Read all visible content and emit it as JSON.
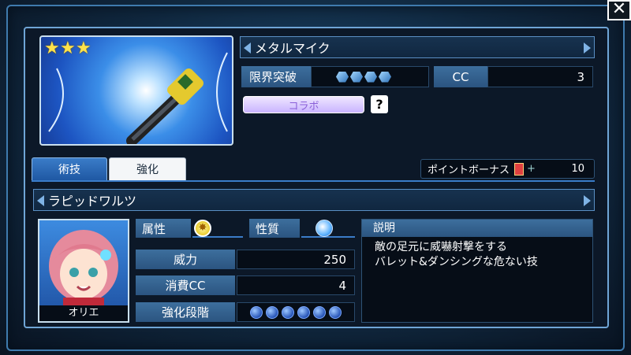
{
  "item": {
    "name": "メタルマイク",
    "stars": 3,
    "limit_break_label": "限界突破",
    "limit_break_level": 4,
    "cc_label": "CC",
    "cc_value": "3",
    "collab_label": "コラボ",
    "help_symbol": "?"
  },
  "tabs": [
    {
      "label": "術技",
      "active": true
    },
    {
      "label": "強化",
      "active": false
    }
  ],
  "point_bonus": {
    "label": "ポイントボーナス",
    "value": "10",
    "plus": "+"
  },
  "skill": {
    "name": "ラピッドワルツ",
    "character_name": "オリエ",
    "attribute_label": "属性",
    "attribute_icon": "light-element-icon",
    "property_label": "性質",
    "property_icon": "water-swirl-icon",
    "power_label": "威力",
    "power_value": "250",
    "cost_label": "消費CC",
    "cost_value": "4",
    "enhance_label": "強化段階",
    "enhance_level": 0,
    "enhance_max": 6,
    "description_label": "説明",
    "description_lines": [
      "敵の足元に威嚇射撃をする",
      "バレット&ダンシングな危ない技"
    ]
  },
  "colors": {
    "accent": "#6fa5d6",
    "gem": "#4da6ff",
    "collab": "#d9c7ff",
    "star": "#ffe24a"
  }
}
